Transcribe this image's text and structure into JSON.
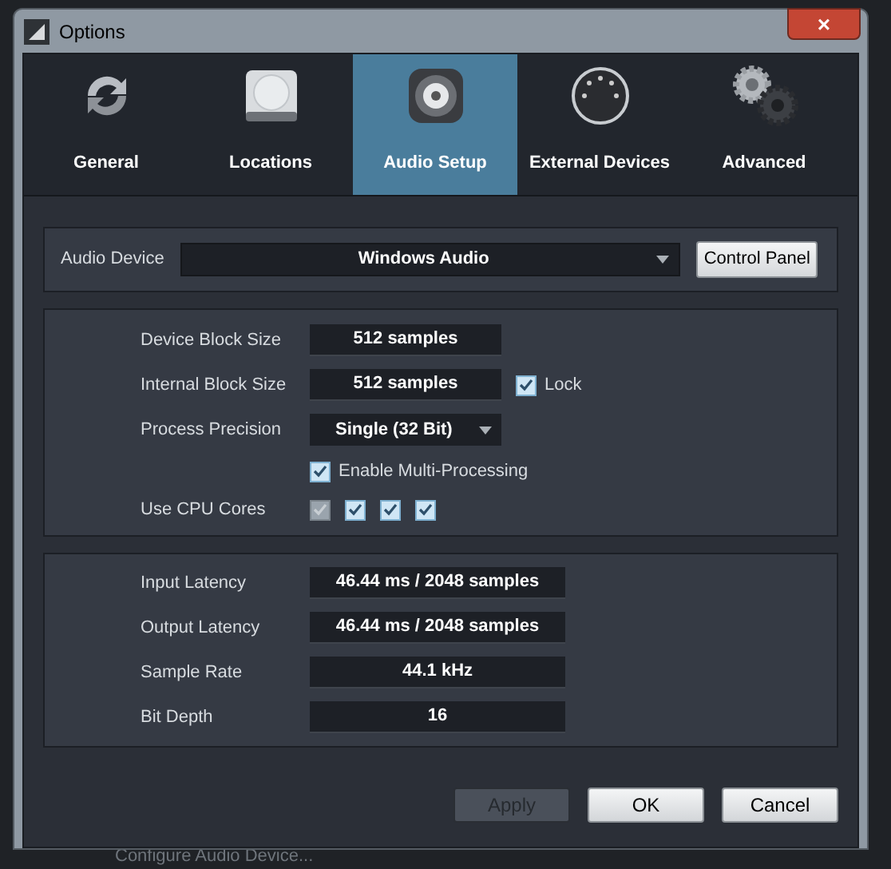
{
  "window": {
    "title": "Options",
    "close": "×"
  },
  "tabs": [
    {
      "label": "General",
      "kind": "general",
      "selected": false
    },
    {
      "label": "Locations",
      "kind": "locations",
      "selected": false
    },
    {
      "label": "Audio Setup",
      "kind": "audio",
      "selected": true
    },
    {
      "label": "External Devices",
      "kind": "external",
      "selected": false
    },
    {
      "label": "Advanced",
      "kind": "advanced",
      "selected": false
    }
  ],
  "audio_device": {
    "label": "Audio Device",
    "value": "Windows Audio",
    "button": "Control Panel"
  },
  "processing": {
    "rows": [
      {
        "kind": "field",
        "label": "Device Block Size",
        "value": "512 samples"
      },
      {
        "kind": "field",
        "label": "Internal Block Size",
        "value": "512 samples",
        "checkbox": {
          "label": "Lock",
          "checked": true
        }
      },
      {
        "kind": "dropdown",
        "label": "Process Precision",
        "value": "Single (32 Bit)"
      },
      {
        "kind": "checkbox",
        "label": "Enable Multi-Processing",
        "checked": true
      },
      {
        "kind": "cores",
        "label": "Use CPU Cores",
        "cores": [
          {
            "checked": true,
            "disabled": true
          },
          {
            "checked": true,
            "disabled": false
          },
          {
            "checked": true,
            "disabled": false
          },
          {
            "checked": true,
            "disabled": false
          }
        ]
      }
    ]
  },
  "latency": [
    {
      "label": "Input Latency",
      "value": "46.44 ms / 2048 samples"
    },
    {
      "label": "Output Latency",
      "value": "46.44 ms / 2048 samples"
    },
    {
      "label": "Sample Rate",
      "value": "44.1 kHz"
    },
    {
      "label": "Bit Depth",
      "value": "16"
    }
  ],
  "buttons": [
    {
      "label": "Apply",
      "disabled": true
    },
    {
      "label": "OK",
      "disabled": false
    },
    {
      "label": "Cancel",
      "disabled": false
    }
  ],
  "background": {
    "status_text": "Configure Audio Device..."
  }
}
